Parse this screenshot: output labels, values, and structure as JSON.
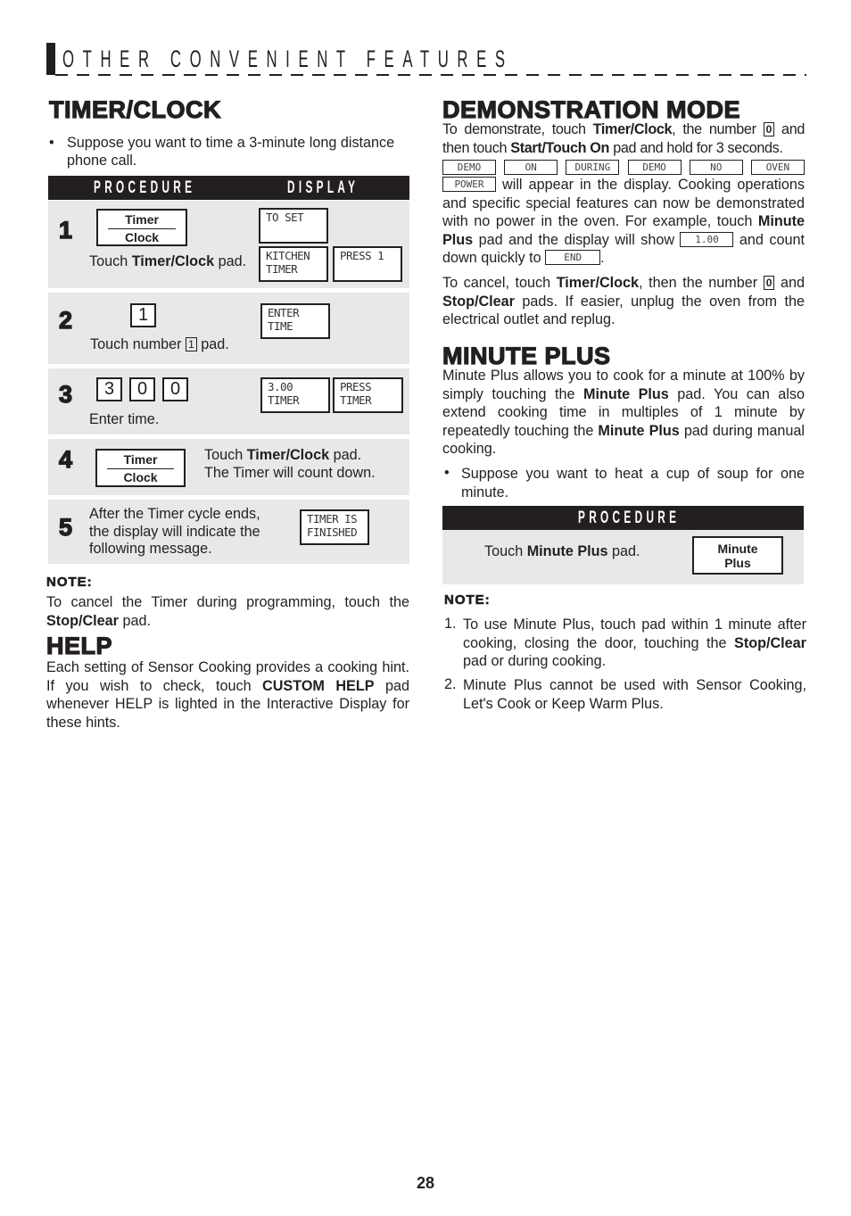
{
  "header": {
    "title": "OTHER CONVENIENT FEATURES"
  },
  "timer_clock": {
    "title": "TIMER/CLOCK",
    "bullet": "Suppose you want to time a 3-minute long distance phone call.",
    "table_headers": {
      "procedure": "PROCEDURE",
      "display": "DISPLAY"
    },
    "steps": [
      {
        "num": "1",
        "pad_top": "Timer",
        "pad_bottom": "Clock",
        "text_pre": "Touch ",
        "text_bold": "Timer/Clock",
        "text_post": " pad.",
        "displays": [
          "TO SET",
          "KITCHEN\nTIMER",
          "PRESS 1"
        ]
      },
      {
        "num": "2",
        "key": "1",
        "text_pre": "Touch number ",
        "text_key": "1",
        "text_post": " pad.",
        "displays": [
          "ENTER\nTIME"
        ]
      },
      {
        "num": "3",
        "keys": [
          "3",
          "0",
          "0"
        ],
        "text": "Enter time.",
        "displays": [
          "3.00\nTIMER",
          "PRESS\nTIMER"
        ]
      },
      {
        "num": "4",
        "pad_top": "Timer",
        "pad_bottom": "Clock",
        "text_pre": "Touch ",
        "text_bold": "Timer/Clock",
        "text_post": " pad.",
        "text_line2": "The Timer will count down."
      },
      {
        "num": "5",
        "text_l1": "After the Timer cycle ends,",
        "text_l2": "the display will indicate the",
        "text_l3": "following message.",
        "displays": [
          "TIMER IS\nFINISHED"
        ]
      }
    ],
    "note_title": "NOTE:",
    "note_pre": "To cancel the Timer during programming, touch the ",
    "note_bold": "Stop/Clear",
    "note_post": " pad."
  },
  "help": {
    "title": "HELP",
    "text_pre": "Each setting of Sensor Cooking provides a cooking hint. If you wish to check, touch ",
    "text_bold": "CUSTOM HELP",
    "text_post": " pad whenever HELP is lighted in the Interactive Display for these hints."
  },
  "demo": {
    "title": "DEMONSTRATION MODE",
    "p1_a": "To demonstrate, touch ",
    "p1_b": "Timer/Clock",
    "p1_c": ", the number ",
    "p1_key": "0",
    "p1_d": " and then touch ",
    "p1_e": "Start/Touch On",
    "p1_f": " pad and hold for 3 seconds.",
    "displays": [
      "DEMO",
      "ON",
      "DURING",
      "DEMO",
      "NO",
      "OVEN"
    ],
    "display_power": "POWER",
    "p2_a": " will appear in the display. Cooking operations and specific special features can now be demonstrated with no power in the oven. For example, touch ",
    "p2_b": "Minute Plus",
    "p2_c": " pad and the display will show ",
    "display_100": "1.00",
    "p2_d": " and count down quickly to ",
    "display_end": "END",
    "p2_e": ".",
    "p3_a": "To cancel, touch ",
    "p3_b": "Timer/Clock",
    "p3_c": ", then the number ",
    "p3_key": "0",
    "p3_d": " and ",
    "p3_e": "Stop/Clear",
    "p3_f": " pads. If easier, unplug the oven from the electrical outlet and replug."
  },
  "minute_plus": {
    "title": "MINUTE PLUS",
    "p1_a": "Minute Plus allows you to cook for a minute at 100% by simply touching the ",
    "p1_b": "Minute Plus",
    "p1_c": " pad. You can also extend cooking time in multiples of 1 minute by repeatedly touching the ",
    "p1_d": "Minute Plus",
    "p1_e": " pad during manual cooking.",
    "bullet": "Suppose you want to heat a cup of soup for one minute.",
    "table_header": "PROCEDURE",
    "step_pre": "Touch ",
    "step_bold": "Minute Plus",
    "step_post": " pad.",
    "pad_l1": "Minute",
    "pad_l2": "Plus",
    "note_title": "NOTE:",
    "notes": [
      {
        "num": "1.",
        "pre": "To use Minute Plus, touch pad within 1 minute after cooking, closing the door, touching the ",
        "bold": "Stop/Clear",
        "post": " pad or during cooking."
      },
      {
        "num": "2.",
        "pre": "Minute Plus cannot be used with Sensor Cooking, Let's Cook or Keep Warm Plus.",
        "bold": "",
        "post": ""
      }
    ]
  },
  "page_number": "28"
}
